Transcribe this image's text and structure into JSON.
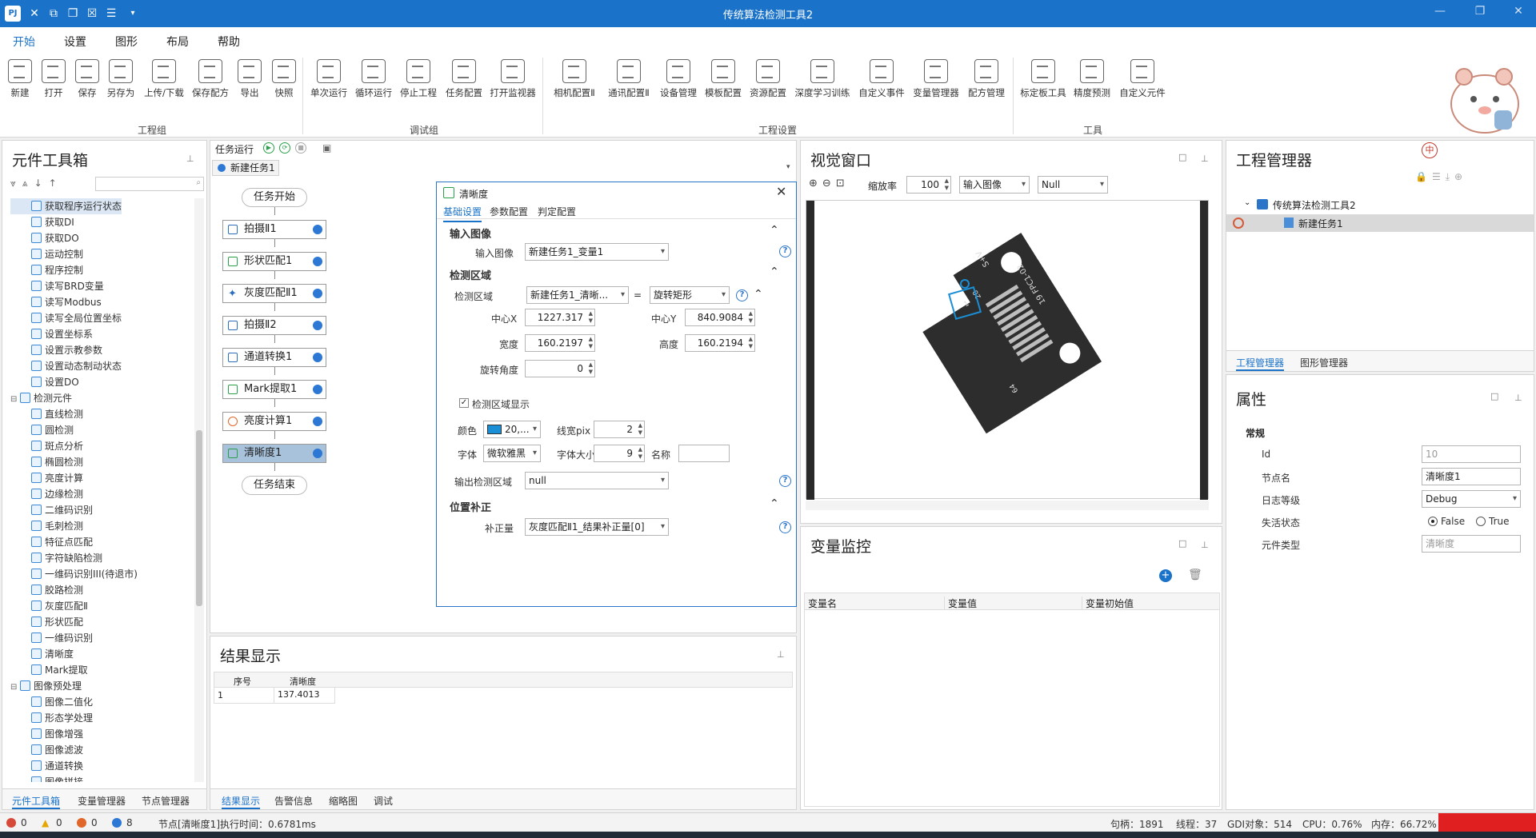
{
  "app": {
    "title": "传统算法检测工具2",
    "logo": "PJ"
  },
  "menu": {
    "tabs": [
      "开始",
      "设置",
      "图形",
      "布局",
      "帮助"
    ]
  },
  "ribbon": {
    "groups": [
      "工程组",
      "调试组",
      "工程设置",
      "工具"
    ],
    "buttons": [
      "新建",
      "打开",
      "保存",
      "另存为",
      "上传/下载",
      "保存配方",
      "导出",
      "快照",
      "单次运行",
      "循环运行",
      "停止工程",
      "任务配置",
      "打开监视器",
      "相机配置Ⅱ",
      "通讯配置Ⅱ",
      "设备管理",
      "模板配置",
      "资源配置",
      "深度学习训练",
      "自定义事件",
      "变量管理器",
      "配方管理",
      "标定板工具",
      "精度预测",
      "自定义元件"
    ]
  },
  "toolbox": {
    "title": "元件工具箱",
    "items": [
      {
        "label": "获取程序运行状态",
        "sel": true
      },
      {
        "label": "获取DI"
      },
      {
        "label": "获取DO"
      },
      {
        "label": "运动控制"
      },
      {
        "label": "程序控制"
      },
      {
        "label": "读写BRD变量"
      },
      {
        "label": "读写Modbus"
      },
      {
        "label": "读写全局位置坐标"
      },
      {
        "label": "设置坐标系"
      },
      {
        "label": "设置示教参数"
      },
      {
        "label": "设置动态制动状态"
      },
      {
        "label": "设置DO"
      },
      {
        "label": "检测元件",
        "group": true
      },
      {
        "label": "直线检测"
      },
      {
        "label": "圆检测"
      },
      {
        "label": "斑点分析"
      },
      {
        "label": "椭圆检测"
      },
      {
        "label": "亮度计算"
      },
      {
        "label": "边缘检测"
      },
      {
        "label": "二维码识别"
      },
      {
        "label": "毛刺检测"
      },
      {
        "label": "特征点匹配"
      },
      {
        "label": "字符缺陷检测"
      },
      {
        "label": "一维码识别III(待退市)"
      },
      {
        "label": "胶路检测"
      },
      {
        "label": "灰度匹配Ⅱ"
      },
      {
        "label": "形状匹配"
      },
      {
        "label": "一维码识别"
      },
      {
        "label": "清晰度"
      },
      {
        "label": "Mark提取"
      },
      {
        "label": "图像预处理",
        "group": true
      },
      {
        "label": "图像二值化"
      },
      {
        "label": "形态学处理"
      },
      {
        "label": "图像增强"
      },
      {
        "label": "图像滤波"
      },
      {
        "label": "通道转换"
      },
      {
        "label": "图像拼接"
      }
    ],
    "bottom_tabs": [
      "元件工具箱",
      "变量管理器",
      "节点管理器"
    ]
  },
  "flow": {
    "toolbar_label": "任务运行",
    "tab": "新建任务1",
    "start": "任务开始",
    "end": "任务结束",
    "nodes": [
      "拍摄Ⅱ1",
      "形状匹配1",
      "灰度匹配Ⅱ1",
      "拍摄Ⅱ2",
      "通道转换1",
      "Mark提取1",
      "亮度计算1",
      "清晰度1"
    ]
  },
  "dialog": {
    "title": "清晰度",
    "tabs": [
      "基础设置",
      "参数配置",
      "判定配置"
    ],
    "sec_input": "输入图像",
    "input_label": "输入图像",
    "input_value": "新建任务1_变量1",
    "sec_region": "检测区域",
    "region_label": "检测区域",
    "region_value": "新建任务1_清晰...",
    "region_eq": "=",
    "region_shape": "旋转矩形",
    "cx_label": "中心X",
    "cx": "1227.317",
    "cy_label": "中心Y",
    "cy": "840.9084",
    "w_label": "宽度",
    "w": "160.2197",
    "h_label": "高度",
    "h": "160.2194",
    "angle_label": "旋转角度",
    "angle": "0",
    "show_label": "检测区域显示",
    "color_label": "颜色",
    "color_value": "20,...",
    "color_swatch": "#1a8fd6",
    "linew_label": "线宽pix",
    "linew": "2",
    "font_label": "字体",
    "font_value": "微软雅黑",
    "fsize_label": "字体大小",
    "fsize": "9",
    "name_label": "名称",
    "name_value": "",
    "output_label": "输出检测区域",
    "output_value": "null",
    "sec_pos": "位置补正",
    "comp_label": "补正量",
    "comp_value": "灰度匹配Ⅱ1_结果补正量[0]"
  },
  "results": {
    "title": "结果显示",
    "headers": [
      "序号",
      "清晰度"
    ],
    "rows": [
      [
        "1",
        "137.4013"
      ]
    ],
    "bottom_tabs": [
      "结果显示",
      "告警信息",
      "缩略图",
      "调试"
    ]
  },
  "vision": {
    "title": "视觉窗口",
    "zoom_label": "缩放率",
    "zoom": "100",
    "image_src": "输入图像",
    "overlay": "Null",
    "pcb_labels": [
      "S+V",
      "20",
      "19 FPC1-02",
      "64",
      "1"
    ]
  },
  "varmon": {
    "title": "变量监控",
    "headers": [
      "变量名",
      "变量值",
      "变量初始值"
    ]
  },
  "project": {
    "title": "工程管理器",
    "root": "传统算法检测工具2",
    "task": "新建任务1",
    "tabs": [
      "工程管理器",
      "图形管理器"
    ]
  },
  "props": {
    "title": "属性",
    "section": "常规",
    "id_label": "Id",
    "id": "10",
    "name_label": "节点名",
    "name": "清晰度1",
    "log_label": "日志等级",
    "log": "Debug",
    "active_label": "失活状态",
    "false_opt": "False",
    "true_opt": "True",
    "type_label": "元件类型",
    "type": "清晰度"
  },
  "status": {
    "errors": "0",
    "warnings": "0",
    "orange": "0",
    "info": "8",
    "message": "节点[清晰度1]执行时间：0.6781ms",
    "handles": "句柄：1891",
    "threads": "线程：37",
    "gdi": "GDI对象：514",
    "cpu": "CPU：0.76%",
    "mem": "内存：66.72%"
  }
}
